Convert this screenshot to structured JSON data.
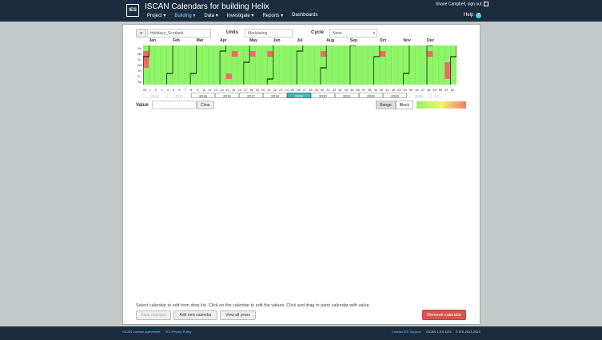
{
  "app": {
    "logo": "IES",
    "title": "ISCAN   Calendars for building Helix",
    "user": "Shane Campbell, sign out"
  },
  "nav": [
    {
      "label": "Project ▾",
      "active": false
    },
    {
      "label": "Building ▾",
      "active": true
    },
    {
      "label": "Data ▾",
      "active": false
    },
    {
      "label": "Investigate ▾",
      "active": false
    },
    {
      "label": "Reports ▾",
      "active": false
    },
    {
      "label": "Dashboards",
      "active": false
    }
  ],
  "help": {
    "label": "Help",
    "icon": "?"
  },
  "form": {
    "calendar_dropdown": "▾",
    "calendar_name": "Holidays_Scotland",
    "units_label": "Units",
    "units_value": "Modulating",
    "cycle_label": "Cycle",
    "cycle_value": "None",
    "cycle_arrow": "▾"
  },
  "calendar": {
    "day_labels": [
      "Su",
      "Mo",
      "Tu",
      "We",
      "Th",
      "Fr",
      "Sa"
    ],
    "months": [
      "Jan",
      "Feb",
      "Mar",
      "Apr",
      "May",
      "Jun",
      "Jul",
      "Aug",
      "Sep",
      "Oct",
      "Nov",
      "Dec"
    ],
    "weeks": [
      "53",
      "1",
      "2",
      "3",
      "4",
      "5",
      "6",
      "7",
      "8",
      "9",
      "10",
      "11",
      "12",
      "13",
      "14",
      "15",
      "16",
      "17",
      "18",
      "19",
      "20",
      "21",
      "22",
      "23",
      "24",
      "25",
      "26",
      "27",
      "28",
      "29",
      "30",
      "31",
      "32",
      "33",
      "34",
      "35",
      "36",
      "37",
      "38",
      "39",
      "40",
      "41",
      "42",
      "43",
      "44",
      "45",
      "46",
      "47",
      "48",
      "49",
      "50",
      "51",
      "52"
    ],
    "years": [
      "2013",
      "2014",
      "2015",
      "2016",
      "2017",
      "2018",
      "2019",
      "2020",
      "2021",
      "2022",
      "2023",
      "2024",
      "20"
    ],
    "selected_year": "2019",
    "base_color": "#8df567",
    "holiday_color": "#f06a6a"
  },
  "value": {
    "label": "Value",
    "placeholder": "",
    "clear_label": "Clear"
  },
  "mode": {
    "range_label": "Range",
    "block_label": "Block"
  },
  "footer_panel": {
    "instructions": "Select calendar to edit from drop list. Click on the calendar to edit the values. Click and drag to paint calendar with value.",
    "save_label": "Save changes",
    "add_label": "Add new calendar",
    "view_label": "View all years",
    "remove_label": "Remove calendar"
  },
  "footer": {
    "license": "ISCAN License agreement",
    "privacy": "IES Privacy Policy",
    "support": "Contact IES Support",
    "version": "ISCAN 1.5.0.4211",
    "copyright": "© IES 2013-2019"
  }
}
